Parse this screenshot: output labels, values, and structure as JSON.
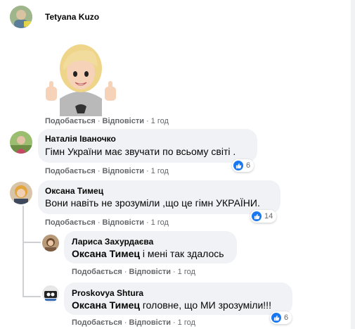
{
  "comments": [
    {
      "author": "Tetyana Kuzo",
      "like_label": "Подобається",
      "reply_label": "Відповісти",
      "time": "1 год"
    },
    {
      "author": "Наталія Іваночко",
      "text": "Гімн України має звучати по всьому світі .",
      "like_label": "Подобається",
      "reply_label": "Відповісти",
      "time": "1 год",
      "reactions": "6"
    },
    {
      "author": "Оксана Тимец",
      "text": "Вони навіть не зрозуміли ,що це гімн УКРАЇНИ.",
      "like_label": "Подобається",
      "reply_label": "Відповісти",
      "time": "1 год",
      "reactions": "14"
    },
    {
      "author": "Лариса Захурдаєва",
      "mention": "Оксана Тимец",
      "text": " і мені так здалось",
      "like_label": "Подобається",
      "reply_label": "Відповісти",
      "time": "1 год"
    },
    {
      "author": "Proskovya Shtura",
      "mention": "Оксана Тимец",
      "text": " головне, що МИ зрозуміли!!!",
      "like_label": "Подобається",
      "reply_label": "Відповісти",
      "time": "1 год",
      "reactions": "6"
    }
  ],
  "separator": "·",
  "reaction_icon": "thumbs-up-icon",
  "colors": {
    "bubble": "#f0f2f5",
    "like_blue": "#1877f2",
    "secondary_text": "#65676b"
  }
}
